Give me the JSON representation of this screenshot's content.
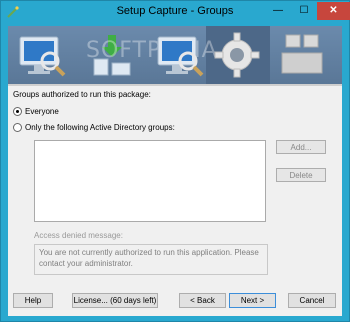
{
  "window": {
    "title": "Setup Capture - Groups",
    "close_glyph": "✕",
    "min_glyph": "—",
    "max_glyph": "☐"
  },
  "banner": {
    "watermark": "SOFTPEDIA",
    "steps": [
      "computer-scan-icon",
      "computer-install-icon",
      "computer-scan-icon",
      "gear-icon",
      "packages-icon"
    ],
    "active_step": 3
  },
  "groups": {
    "heading": "Groups authorized to run this package:",
    "options": [
      "Everyone",
      "Only the following Active Directory groups:"
    ],
    "selected": 0,
    "items": []
  },
  "side_buttons": {
    "add": "Add...",
    "delete": "Delete"
  },
  "access": {
    "label": "Access denied message:",
    "message": "You are not currently authorized to run this application. Please contact your administrator."
  },
  "buttons": {
    "help": "Help",
    "license": "License... (60 days left)",
    "back": "< Back",
    "next": "Next >",
    "cancel": "Cancel"
  },
  "colors": {
    "frame": "#29a8cf",
    "close": "#c7463d",
    "banner": "#5a7797"
  }
}
